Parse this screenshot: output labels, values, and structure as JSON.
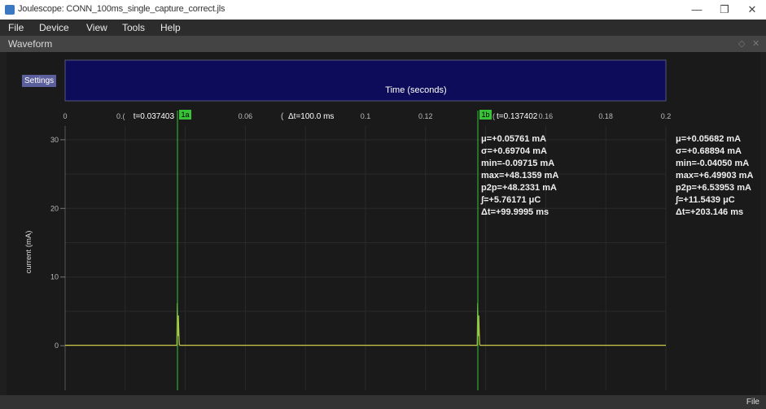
{
  "window": {
    "title": "Joulescope: CONN_100ms_single_capture_correct.jls",
    "minimize_glyph": "—",
    "maximize_glyph": "❐",
    "close_glyph": "✕"
  },
  "menu": {
    "items": [
      "File",
      "Device",
      "View",
      "Tools",
      "Help"
    ]
  },
  "dock": {
    "title": "Waveform",
    "float_glyph": "◇",
    "close_glyph": "✕"
  },
  "settings_label": "Settings",
  "status": {
    "right_text": "File"
  },
  "colors": {
    "timebar": "#0c0c5a",
    "trace": "#c9c94a",
    "marker": "#38c238",
    "grid": "#2a2a2a"
  },
  "chart_data": {
    "type": "line",
    "xlabel": "Time (seconds)",
    "ylabel": "current (mA)",
    "xlim": [
      0,
      0.2
    ],
    "ylim": [
      -6.5,
      32
    ],
    "x_ticks": [
      "0",
      "0.02",
      "0.04",
      "0.06",
      "0.08",
      "0.1",
      "0.12",
      "0.14",
      "0.16",
      "0.18",
      "0.2"
    ],
    "y_ticks": [
      0,
      10,
      20,
      30
    ],
    "series": [
      {
        "x": [
          0,
          0.0372,
          0.03735,
          0.0375,
          0.0376,
          0.0377,
          0.03785,
          0.038,
          0.0382,
          0.1372,
          0.13735,
          0.1375,
          0.1376,
          0.1377,
          0.13785,
          0.138,
          0.1382,
          0.2
        ],
        "y": [
          0.06,
          0.06,
          6.2,
          3.0,
          1.4,
          4.4,
          2.0,
          0.2,
          0.06,
          0.06,
          6.2,
          3.0,
          1.4,
          4.4,
          2.0,
          0.2,
          0.06,
          0.06
        ]
      }
    ],
    "markers": [
      {
        "label": "1a",
        "x": 0.037403,
        "time_text": "t=0.037403",
        "fragment": "0.("
      },
      {
        "label": "1b",
        "x": 0.137402,
        "time_text": "t=0.137402",
        "fragment": "("
      }
    ],
    "delta_text": "Δt=100.0 ms",
    "delta_fragment": "(",
    "stats_dual": [
      "μ=+0.05761 mA",
      "σ=+0.69704 mA",
      "min=-0.09715 mA",
      "max=+48.1359 mA",
      "p2p=+48.2331 mA",
      "∫=+5.76171 μC",
      "Δt=+99.9995 ms"
    ],
    "stats_total": [
      "μ=+0.05682 mA",
      "σ=+0.68894 mA",
      "min=-0.04050 mA",
      "max=+6.49903 mA",
      "p2p=+6.53953 mA",
      "∫=+11.5439 μC",
      "Δt=+203.146 ms"
    ]
  }
}
